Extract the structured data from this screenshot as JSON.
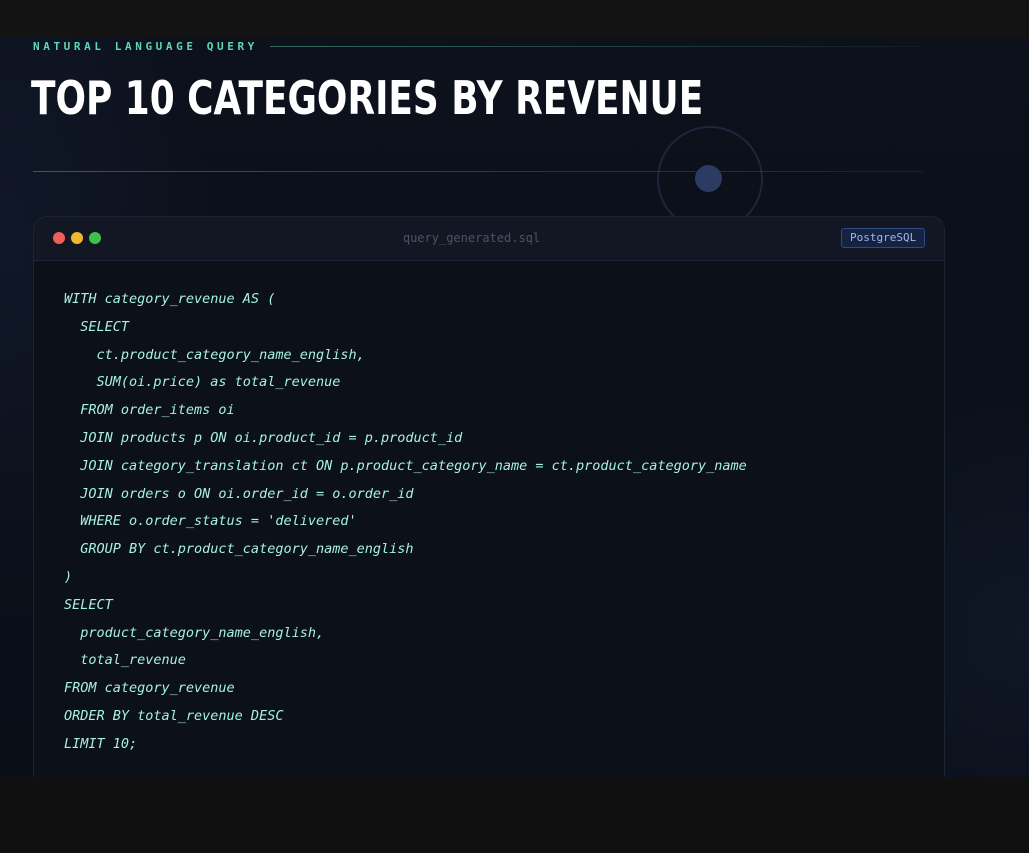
{
  "header": {
    "eyebrow": "NATURAL LANGUAGE QUERY",
    "title": "TOP 10 CATEGORIES BY REVENUE"
  },
  "code_window": {
    "filename": "query_generated.sql",
    "badge": "PostgreSQL",
    "lines": [
      "WITH category_revenue AS (",
      "  SELECT",
      "    ct.product_category_name_english,",
      "    SUM(oi.price) as total_revenue",
      "  FROM order_items oi",
      "  JOIN products p ON oi.product_id = p.product_id",
      "  JOIN category_translation ct ON p.product_category_name = ct.product_category_name",
      "  JOIN orders o ON oi.order_id = o.order_id",
      "  WHERE o.order_status = 'delivered'",
      "  GROUP BY ct.product_category_name_english",
      ")",
      "SELECT",
      "  product_category_name_english,",
      "  total_revenue",
      "FROM category_revenue",
      "ORDER BY total_revenue DESC",
      "LIMIT 10;"
    ]
  },
  "colors": {
    "accent": "#5fd6b3",
    "code_text": "#a6f2de",
    "badge": "#9db8f0"
  }
}
